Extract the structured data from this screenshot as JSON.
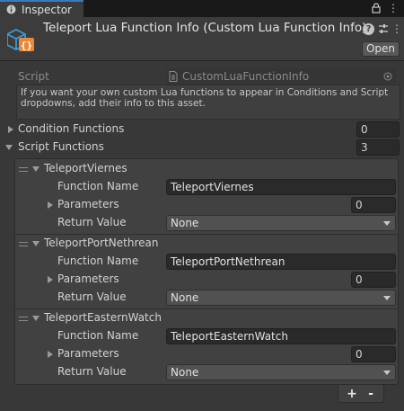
{
  "tab": {
    "label": "Inspector",
    "icon": "info-icon"
  },
  "header": {
    "title": "Teleport Lua Function Info (Custom Lua Function Info)",
    "open_label": "Open",
    "icons": [
      "help-icon",
      "preset-sliders-icon",
      "kebab-menu-icon"
    ]
  },
  "script": {
    "label": "Script",
    "value": "CustomLuaFunctionInfo"
  },
  "info_text": "If you want your own custom Lua functions to appear in Conditions and Script dropdowns, add their info to this asset.",
  "condition_functions": {
    "label": "Condition Functions",
    "count": "0",
    "expanded": false
  },
  "script_functions": {
    "label": "Script Functions",
    "count": "3",
    "expanded": true,
    "elements": [
      {
        "name": "TeleportViernes",
        "function_name_label": "Function Name",
        "function_name": "TeleportViernes",
        "parameters_label": "Parameters",
        "parameters_count": "0",
        "return_value_label": "Return Value",
        "return_value": "None"
      },
      {
        "name": "TeleportPortNethrean",
        "function_name_label": "Function Name",
        "function_name": "TeleportPortNethrean",
        "parameters_label": "Parameters",
        "parameters_count": "0",
        "return_value_label": "Return Value",
        "return_value": "None"
      },
      {
        "name": "TeleportEasternWatch",
        "function_name_label": "Function Name",
        "function_name": "TeleportEasternWatch",
        "parameters_label": "Parameters",
        "parameters_count": "0",
        "return_value_label": "Return Value",
        "return_value": "None"
      }
    ]
  },
  "list_footer": {
    "add_label": "+",
    "remove_label": "-"
  },
  "colors": {
    "accent": "#3a79bb",
    "icon_blue": "#3d9ad8",
    "icon_orange": "#e8883a"
  }
}
